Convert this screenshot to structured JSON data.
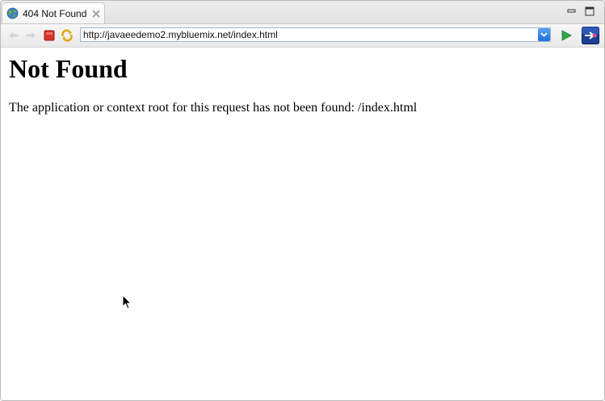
{
  "tab": {
    "title": "404 Not Found",
    "icon": "globe-icon"
  },
  "window_controls": [
    "minimize-icon",
    "maximize-icon"
  ],
  "toolbar": {
    "back_icon": "back-arrow-icon",
    "forward_icon": "forward-arrow-icon",
    "stop_icon": "stop-icon",
    "refresh_icon": "refresh-icon",
    "go_icon": "go-play-icon",
    "eclipse_icon": "eclipse-browser-icon"
  },
  "address": {
    "url": "http://javaeedemo2.mybluemix.net/index.html"
  },
  "page": {
    "heading": "Not Found",
    "message": "The application or context root for this request has not been found: /index.html"
  },
  "colors": {
    "stop_red": "#d9342b",
    "refresh_gold": "#e3a400",
    "go_green": "#2fa84a",
    "dropdown_blue": "#2b79e0"
  }
}
